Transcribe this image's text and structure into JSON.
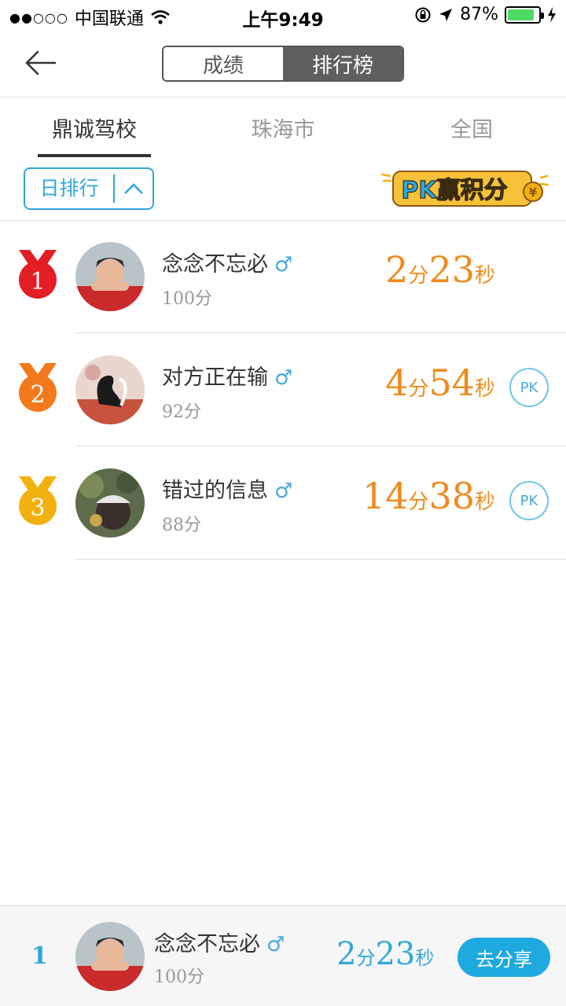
{
  "status_bar": {
    "signal_dots": "●●○○○",
    "carrier": "中国联通",
    "time": "上午9:49",
    "battery_percent": "87%",
    "battery_level": 0.87
  },
  "nav": {
    "segment": [
      "成绩",
      "排行榜"
    ],
    "active_segment": 1
  },
  "region_tabs": [
    "鼎诚驾校",
    "珠海市",
    "全国"
  ],
  "filter": {
    "label": "日排行"
  },
  "pk_banner_text": "PK赢积分",
  "colors": {
    "accent_blue": "#2fa8dc",
    "time_orange": "#f08a1c",
    "medal_gold": "#f3b10f",
    "medal_orange": "#f27a1d",
    "medal_red": "#e31e24"
  },
  "ranking": [
    {
      "rank": "1",
      "name": "念念不忘必",
      "gender": "♂",
      "score": "100分",
      "min": "2",
      "min_unit": "分",
      "sec": "23",
      "sec_unit": "秒",
      "pk": ""
    },
    {
      "rank": "2",
      "name": "对方正在输",
      "gender": "♂",
      "score": "92分",
      "min": "4",
      "min_unit": "分",
      "sec": "54",
      "sec_unit": "秒",
      "pk": "PK"
    },
    {
      "rank": "3",
      "name": "错过的信息",
      "gender": "♂",
      "score": "88分",
      "min": "14",
      "min_unit": "分",
      "sec": "38",
      "sec_unit": "秒",
      "pk": "PK"
    }
  ],
  "my_rank": {
    "rank": "1",
    "name": "念念不忘必",
    "gender": "♂",
    "score": "100分",
    "min": "2",
    "min_unit": "分",
    "sec": "23",
    "sec_unit": "秒",
    "share_label": "去分享"
  }
}
